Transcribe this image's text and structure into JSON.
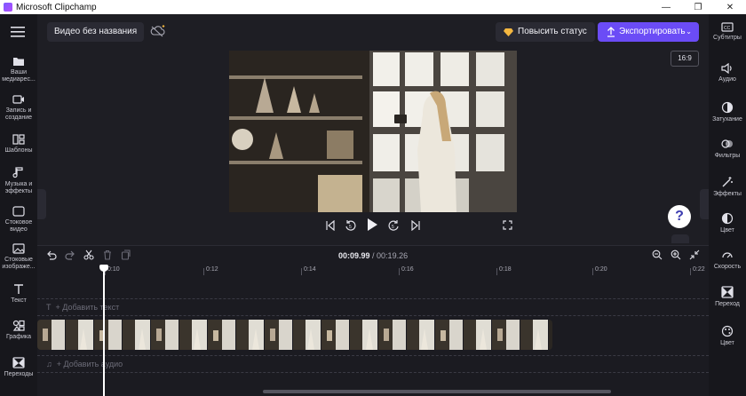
{
  "window": {
    "title": "Microsoft Clipchamp",
    "minimize": "—",
    "maximize": "❐",
    "close": "✕"
  },
  "left_nav": [
    {
      "icon": "folder-icon",
      "label": "Ваши медиарес..."
    },
    {
      "icon": "camera-icon",
      "label": "Запись и создание"
    },
    {
      "icon": "templates-icon",
      "label": "Шаблоны"
    },
    {
      "icon": "music-icon",
      "label": "Музыка и эффекты"
    },
    {
      "icon": "stock-video-icon",
      "label": "Стоковое видео"
    },
    {
      "icon": "stock-image-icon",
      "label": "Стоковые изображе..."
    },
    {
      "icon": "text-icon",
      "label": "Текст"
    },
    {
      "icon": "graphics-icon",
      "label": "Графика"
    },
    {
      "icon": "transitions-icon",
      "label": "Переходы"
    }
  ],
  "right_nav": [
    {
      "icon": "captions-icon",
      "label": "Субтитры"
    },
    {
      "icon": "audio-icon",
      "label": "Аудио"
    },
    {
      "icon": "fade-icon",
      "label": "Затухание"
    },
    {
      "icon": "filters-icon",
      "label": "Фильтры"
    },
    {
      "icon": "effects-icon",
      "label": "Эффекты"
    },
    {
      "icon": "color-icon",
      "label": "Цвет"
    },
    {
      "icon": "speed-icon",
      "label": "Скорость"
    },
    {
      "icon": "transition-icon",
      "label": "Переход"
    },
    {
      "icon": "color-palette-icon",
      "label": "Цвет"
    }
  ],
  "topbar": {
    "project_name": "Видео без названия",
    "upgrade_label": "Повысить статус",
    "export_label": "Экспортировать",
    "aspect_ratio": "16:9"
  },
  "timeline": {
    "current_time": "00:09.99",
    "separator": " / ",
    "total_time": "00:19.26",
    "ticks": [
      "0:10",
      "0:12",
      "0:14",
      "0:16",
      "0:18",
      "0:20",
      "0:22"
    ],
    "add_text": "+ Добавить текст",
    "add_audio": "+ Добавить аудио"
  },
  "help": "?",
  "colors": {
    "accent": "#6b4cf6",
    "background": "#1e1e24",
    "panel": "#17171c"
  }
}
